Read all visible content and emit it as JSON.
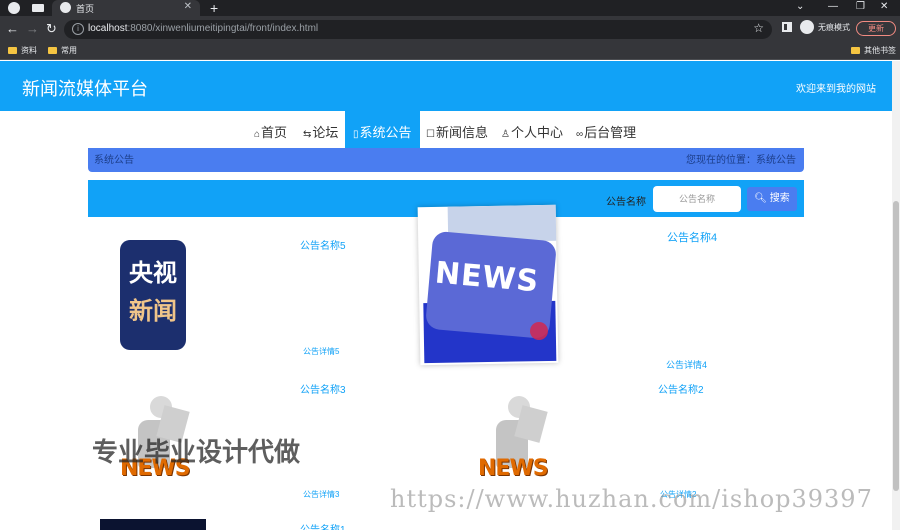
{
  "browser": {
    "tab_title": "首页",
    "url_host": "localhost",
    "url_rest": ":8080/xinwenliumeitipingtai/front/index.html",
    "incognito_label": "无痕模式",
    "update_label": "更新",
    "bookmarks": [
      "资料",
      "常用"
    ],
    "bookmarks_right": "其他书签"
  },
  "header": {
    "title": "新闻流媒体平台",
    "welcome": "欢迎来到我的网站"
  },
  "nav": {
    "items": [
      {
        "label": "首页"
      },
      {
        "label": "论坛"
      },
      {
        "label": "系统公告"
      },
      {
        "label": "新闻信息"
      },
      {
        "label": "个人中心"
      },
      {
        "label": "后台管理"
      }
    ]
  },
  "breadcrumb": {
    "left": "系统公告",
    "right": "您现在的位置：系统公告"
  },
  "search": {
    "label": "公告名称",
    "placeholder": "公告名称",
    "button": "搜索"
  },
  "cards": [
    {
      "name": "公告名称5",
      "detail": "公告详情5"
    },
    {
      "name": "公告名称4",
      "detail": "公告详情4"
    },
    {
      "name": "公告名称3",
      "detail": "公告详情3"
    },
    {
      "name": "公告名称2",
      "detail": "公告详情2"
    },
    {
      "name": "公告名称1"
    }
  ],
  "images": {
    "cctv": [
      "央视",
      "新闻"
    ],
    "news": "NEWS"
  },
  "watermark": {
    "text": "专业毕业设计代做",
    "url": "https://www.huzhan.com/ishop39397"
  }
}
